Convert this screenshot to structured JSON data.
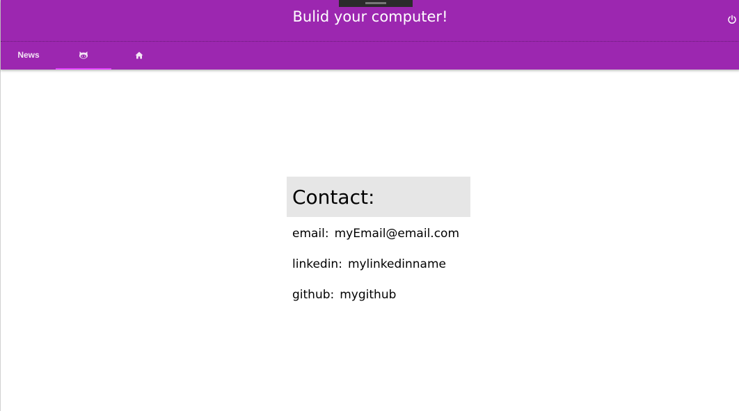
{
  "header": {
    "title": "Bulid your computer!",
    "background": "#9c27b0",
    "power_icon": "power-icon"
  },
  "tabs": [
    {
      "label": "News",
      "icon": null,
      "active": false
    },
    {
      "label": "",
      "icon": "github-icon",
      "active": true
    },
    {
      "label": "",
      "icon": "home-icon",
      "active": false
    }
  ],
  "contact": {
    "heading": "Contact:",
    "email_label": "email:",
    "email_value": "myEmail@email.com",
    "linkedin_label": "linkedin:",
    "linkedin_value": "mylinkedinname",
    "github_label": "github:",
    "github_value": "mygithub"
  }
}
